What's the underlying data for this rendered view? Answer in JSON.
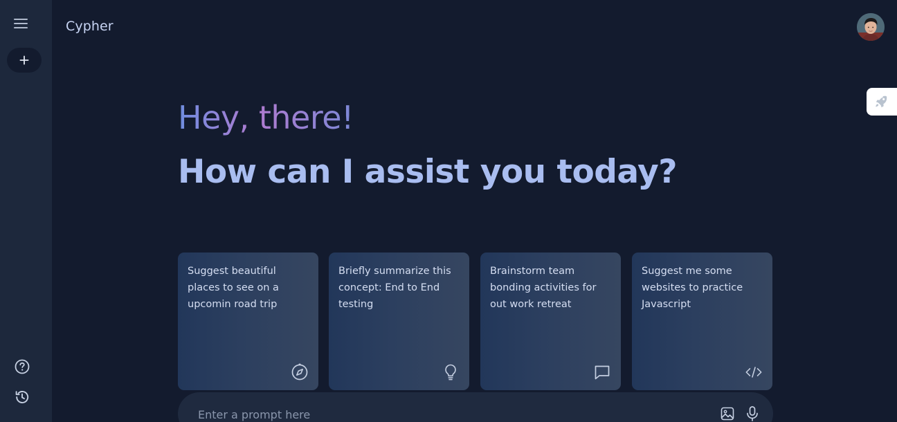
{
  "app": {
    "brand": "Cypher"
  },
  "sidebar": {
    "icons": [
      "menu-icon",
      "plus-icon",
      "help-icon",
      "history-icon"
    ]
  },
  "greeting": {
    "hello": "Hey, there!",
    "question": "How can I assist you today?",
    "hello_gradient": [
      "#6f8ddf",
      "#b07bd0",
      "#7c88d6"
    ]
  },
  "cards": [
    {
      "text": "Suggest beautiful places to see on a upcomin road trip",
      "icon": "compass-icon"
    },
    {
      "text": "Briefly summarize this concept: End to End testing",
      "icon": "lightbulb-icon"
    },
    {
      "text": "Brainstorm team bonding activities for out work retreat",
      "icon": "chat-bubble-icon"
    },
    {
      "text": "Suggest me some websites to practice Javascript",
      "icon": "code-icon"
    }
  ],
  "prompt": {
    "placeholder": "Enter a prompt here",
    "value": ""
  },
  "colors": {
    "background": "#131b2e",
    "sidebar": "#1d283c",
    "card": "#2c3f5f",
    "accent_text": "#a9bdf0"
  }
}
